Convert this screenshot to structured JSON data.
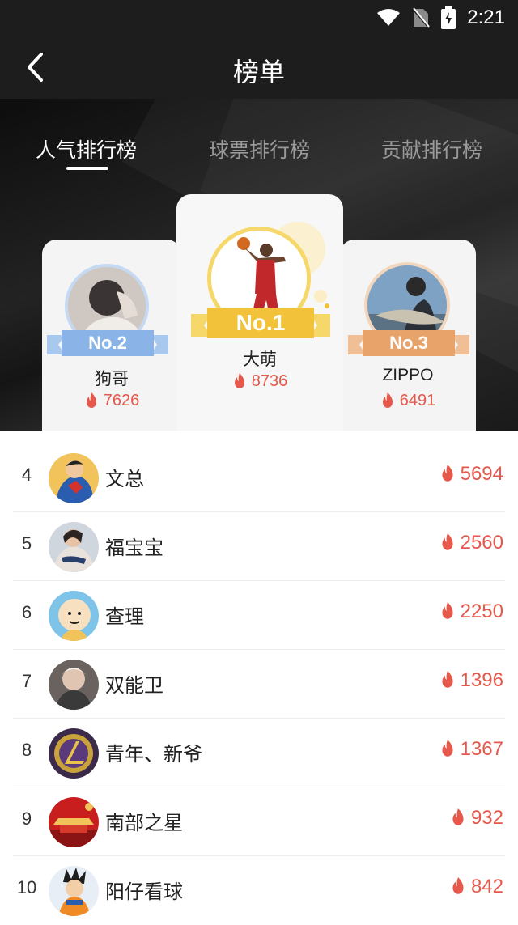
{
  "status_bar": {
    "time": "2:21"
  },
  "nav": {
    "title": "榜单"
  },
  "tabs": [
    {
      "label": "人气排行榜",
      "active": true
    },
    {
      "label": "球票排行榜",
      "active": false
    },
    {
      "label": "贡献排行榜",
      "active": false
    }
  ],
  "top3": {
    "first": {
      "badge": "No.1",
      "name": "大萌",
      "score": "8736"
    },
    "second": {
      "badge": "No.2",
      "name": "狗哥",
      "score": "7626"
    },
    "third": {
      "badge": "No.3",
      "name": "ZIPPO",
      "score": "6491"
    }
  },
  "list": [
    {
      "rank": "4",
      "name": "文总",
      "score": "5694"
    },
    {
      "rank": "5",
      "name": "福宝宝",
      "score": "2560"
    },
    {
      "rank": "6",
      "name": "查理",
      "score": "2250"
    },
    {
      "rank": "7",
      "name": "双能卫",
      "score": "1396"
    },
    {
      "rank": "8",
      "name": "青年、新爷",
      "score": "1367"
    },
    {
      "rank": "9",
      "name": "南部之星",
      "score": "932"
    },
    {
      "rank": "10",
      "name": "阳仔看球",
      "score": "842"
    }
  ],
  "colors": {
    "accent": "#e5584b",
    "gold": "#f2c23a",
    "silver": "#8ab4e8",
    "bronze": "#e8a36a",
    "header_bg": "#1d1d1d"
  }
}
